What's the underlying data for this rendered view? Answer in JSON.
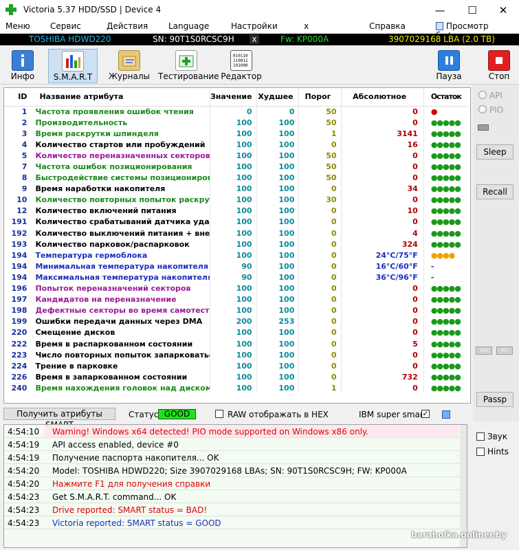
{
  "window": {
    "title": "Victoria 5.37 HDD/SSD | Device 4",
    "minimize": "—",
    "maximize": "☐",
    "close": "✕"
  },
  "menu": {
    "items": [
      "Меню",
      "Сервис",
      "Действия",
      "Language",
      "Настройки",
      "x",
      "Справка"
    ],
    "clipboard_label": "Просмотр буфера"
  },
  "device": {
    "model": "TOSHIBA HDWD220",
    "serial": "SN: 90T1S0RCSC9H",
    "close": "x",
    "firmware": "Fw: KP000A",
    "lba": "3907029168 LBA (2.0 TB)"
  },
  "toolbar": {
    "info": "Инфо",
    "smart": "S.M.A.R.T",
    "journals": "Журналы",
    "testing": "Тестирование",
    "editor": "Редактор",
    "pause": "Пауза",
    "stop": "Стоп"
  },
  "table": {
    "headers": [
      "ID",
      "Название атрибута",
      "Значение",
      "Худшее",
      "Порог",
      "Абсолютное",
      "Остаток"
    ],
    "rows": [
      {
        "id": "1",
        "name": "Частота проявления ошибок чтения",
        "value": "0",
        "worst": "0",
        "thr": "50",
        "raw": "0",
        "rem": "●",
        "name_color": "#1a8a1a",
        "rem_color": "#d00000"
      },
      {
        "id": "2",
        "name": "Производительность",
        "value": "100",
        "worst": "100",
        "thr": "50",
        "raw": "0",
        "rem": "●●●●●",
        "name_color": "#1a8a1a",
        "rem_color": "#1a9a1a"
      },
      {
        "id": "3",
        "name": "Время раскрутки шпинделя",
        "value": "100",
        "worst": "100",
        "thr": "1",
        "raw": "3141",
        "rem": "●●●●●",
        "name_color": "#1a8a1a",
        "rem_color": "#1a9a1a"
      },
      {
        "id": "4",
        "name": "Количество стартов или пробуждений",
        "value": "100",
        "worst": "100",
        "thr": "0",
        "raw": "16",
        "rem": "●●●●●",
        "name_color": "#000000",
        "rem_color": "#1a9a1a"
      },
      {
        "id": "5",
        "name": "Количество переназначенных секторов",
        "value": "100",
        "worst": "100",
        "thr": "50",
        "raw": "0",
        "rem": "●●●●●",
        "name_color": "#9a1a9a",
        "rem_color": "#1a9a1a"
      },
      {
        "id": "7",
        "name": "Частота ошибок позиционирования",
        "value": "100",
        "worst": "100",
        "thr": "50",
        "raw": "0",
        "rem": "●●●●●",
        "name_color": "#1a8a1a",
        "rem_color": "#1a9a1a"
      },
      {
        "id": "8",
        "name": "Быстродействие системы позиционирования",
        "value": "100",
        "worst": "100",
        "thr": "50",
        "raw": "0",
        "rem": "●●●●●",
        "name_color": "#1a8a1a",
        "rem_color": "#1a9a1a"
      },
      {
        "id": "9",
        "name": "Время наработки накопителя",
        "value": "100",
        "worst": "100",
        "thr": "0",
        "raw": "34",
        "rem": "●●●●●",
        "name_color": "#000000",
        "rem_color": "#1a9a1a"
      },
      {
        "id": "10",
        "name": "Количество повторных попыток раскрутки",
        "value": "100",
        "worst": "100",
        "thr": "30",
        "raw": "0",
        "rem": "●●●●●",
        "name_color": "#1a8a1a",
        "rem_color": "#1a9a1a"
      },
      {
        "id": "12",
        "name": "Количество включений питания",
        "value": "100",
        "worst": "100",
        "thr": "0",
        "raw": "10",
        "rem": "●●●●●",
        "name_color": "#000000",
        "rem_color": "#1a9a1a"
      },
      {
        "id": "191",
        "name": "Количество срабатываний датчика удара",
        "value": "100",
        "worst": "100",
        "thr": "0",
        "raw": "0",
        "rem": "●●●●●",
        "name_color": "#000000",
        "rem_color": "#1a9a1a"
      },
      {
        "id": "192",
        "name": "Количество выключений питания + внезапн...",
        "value": "100",
        "worst": "100",
        "thr": "0",
        "raw": "4",
        "rem": "●●●●●",
        "name_color": "#000000",
        "rem_color": "#1a9a1a"
      },
      {
        "id": "193",
        "name": "Количество парковок/распарковок",
        "value": "100",
        "worst": "100",
        "thr": "0",
        "raw": "324",
        "rem": "●●●●●",
        "name_color": "#000000",
        "rem_color": "#1a9a1a"
      },
      {
        "id": "194",
        "name": "Температура гермоблока",
        "value": "100",
        "worst": "100",
        "thr": "0",
        "raw": "24°C/75°F",
        "rem": "●●●●",
        "name_color": "#1a2fbe",
        "rem_color": "#f0a000",
        "raw_color": "#1a2fbe"
      },
      {
        "id": "194",
        "name": "Минимальная температура накопителя",
        "value": "90",
        "worst": "100",
        "thr": "0",
        "raw": "16°C/60°F",
        "rem": "-",
        "name_color": "#1a2fbe",
        "rem_color": "#1a2fbe",
        "raw_color": "#1a2fbe"
      },
      {
        "id": "194",
        "name": "Максимальная температура накопителя",
        "value": "90",
        "worst": "100",
        "thr": "0",
        "raw": "36°C/96°F",
        "rem": "-",
        "name_color": "#1a2fbe",
        "rem_color": "#1a2fbe",
        "raw_color": "#1a2fbe"
      },
      {
        "id": "196",
        "name": "Попыток переназначений секторов",
        "value": "100",
        "worst": "100",
        "thr": "0",
        "raw": "0",
        "rem": "●●●●●",
        "name_color": "#9a1a9a",
        "rem_color": "#1a9a1a"
      },
      {
        "id": "197",
        "name": "Кандидатов на переназначение",
        "value": "100",
        "worst": "100",
        "thr": "0",
        "raw": "0",
        "rem": "●●●●●",
        "name_color": "#9a1a9a",
        "rem_color": "#1a9a1a"
      },
      {
        "id": "198",
        "name": "Дефектные секторы во время самотеста",
        "value": "100",
        "worst": "100",
        "thr": "0",
        "raw": "0",
        "rem": "●●●●●",
        "name_color": "#9a1a9a",
        "rem_color": "#1a9a1a"
      },
      {
        "id": "199",
        "name": "Ошибки передачи данных через DMA",
        "value": "200",
        "worst": "253",
        "thr": "0",
        "raw": "0",
        "rem": "●●●●●",
        "name_color": "#000000",
        "rem_color": "#1a9a1a"
      },
      {
        "id": "220",
        "name": "Смещение дисков",
        "value": "100",
        "worst": "100",
        "thr": "0",
        "raw": "0",
        "rem": "●●●●●",
        "name_color": "#000000",
        "rem_color": "#1a9a1a"
      },
      {
        "id": "222",
        "name": "Время в распаркованном состоянии",
        "value": "100",
        "worst": "100",
        "thr": "0",
        "raw": "5",
        "rem": "●●●●●",
        "name_color": "#000000",
        "rem_color": "#1a9a1a"
      },
      {
        "id": "223",
        "name": "Число повторных попыток запарковаться",
        "value": "100",
        "worst": "100",
        "thr": "0",
        "raw": "0",
        "rem": "●●●●●",
        "name_color": "#000000",
        "rem_color": "#1a9a1a"
      },
      {
        "id": "224",
        "name": "Трение в парковке",
        "value": "100",
        "worst": "100",
        "thr": "0",
        "raw": "0",
        "rem": "●●●●●",
        "name_color": "#000000",
        "rem_color": "#1a9a1a"
      },
      {
        "id": "226",
        "name": "Время в запаркованном состоянии",
        "value": "100",
        "worst": "100",
        "thr": "0",
        "raw": "732",
        "rem": "●●●●●",
        "name_color": "#000000",
        "rem_color": "#1a9a1a"
      },
      {
        "id": "240",
        "name": "Время нахождения головок над диском",
        "value": "100",
        "worst": "100",
        "thr": "1",
        "raw": "0",
        "rem": "●●●●●",
        "name_color": "#1a8a1a",
        "rem_color": "#1a9a1a"
      }
    ]
  },
  "side": {
    "api": "API",
    "pio": "PIO",
    "sleep": "Sleep",
    "recall": "Recall",
    "wr": "WR",
    "rd": "RD",
    "passp": "Passp"
  },
  "status": {
    "get_button": "Получить атрибуты SMART",
    "status_label": "Статус:",
    "status_value": "GOOD",
    "raw_hex_label": "RAW отображать в HEX",
    "ibm_label": "IBM super smart:",
    "ibm_checked": "✓"
  },
  "log": [
    {
      "time": "4:54:10",
      "msg": "Warning! Windows x64 detected! PIO mode supported on Windows x86 only.",
      "color": "#e00000"
    },
    {
      "time": "4:54:19",
      "msg": "API access enabled, device #0",
      "color": "#000000"
    },
    {
      "time": "4:54:19",
      "msg": "Получение паспорта накопителя... OK",
      "color": "#000000"
    },
    {
      "time": "4:54:20",
      "msg": "Model: TOSHIBA HDWD220; Size 3907029168 LBAs; SN: 90T1S0RCSC9H; FW: KP000A",
      "color": "#000000"
    },
    {
      "time": "4:54:20",
      "msg": "Нажмите F1 для получения справки",
      "color": "#e00000"
    },
    {
      "time": "4:54:23",
      "msg": "Get S.M.A.R.T. command... OK",
      "color": "#000000"
    },
    {
      "time": "4:54:23",
      "msg": "Drive reported: SMART status = BAD!",
      "color": "#e00000"
    },
    {
      "time": "4:54:23",
      "msg": "Victoria reported: SMART status = GOOD",
      "color": "#1a2fbe"
    }
  ],
  "right_checks": {
    "sound": "Звук",
    "hints": "Hints"
  },
  "watermark": "baraholka.onliner.by"
}
